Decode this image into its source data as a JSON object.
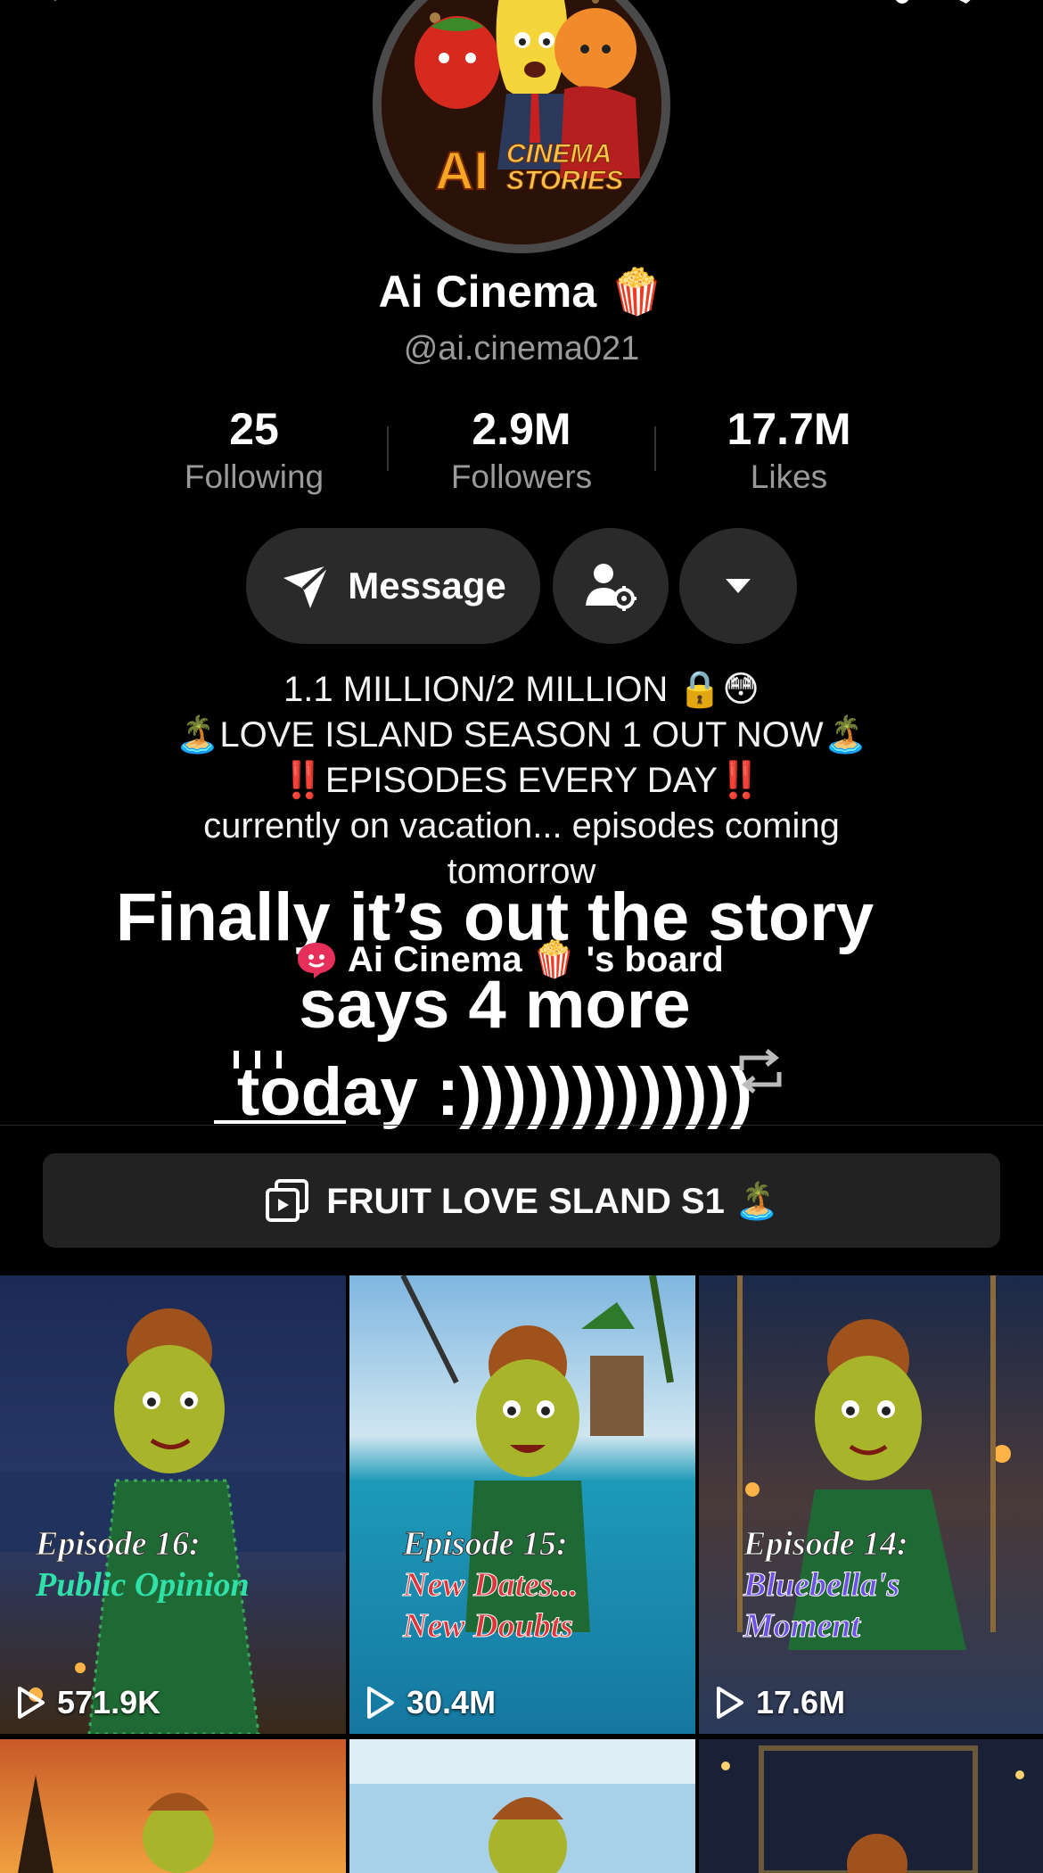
{
  "profile": {
    "name": "Ai Cinema",
    "name_emoji": "🍿",
    "handle": "@ai.cinema021",
    "avatar_text": [
      "AI",
      "CINEMA",
      "STORIES"
    ]
  },
  "stats": [
    {
      "value": "25",
      "label": "Following"
    },
    {
      "value": "2.9M",
      "label": "Followers"
    },
    {
      "value": "17.7M",
      "label": "Likes"
    }
  ],
  "actions": {
    "message_label": "Message"
  },
  "bio": {
    "line1": "1.1 MILLION/2 MILLION 🔒😳",
    "line2": "🏝️LOVE ISLAND SEASON 1 OUT NOW🏝️",
    "line3_marks": "‼️",
    "line3_text": "EPISODES EVERY DAY",
    "line4": "currently on vacation... episodes coming",
    "line5": "tomorrow"
  },
  "overlay_caption": {
    "line1": "Finally it’s out the story",
    "line2": "says 4 more",
    "line3": "today :)))))))))))))"
  },
  "board": {
    "label": "Ai Cinema 🍿 's board"
  },
  "playlist": {
    "label": "FRUIT LOVE SLAND S1 🏝️"
  },
  "videos": [
    {
      "title": "Episode 16:",
      "subtitle": [
        "Public Opinion"
      ],
      "views": "571.9K",
      "subtitle_color": "#2fe0a8"
    },
    {
      "title": "Episode 15:",
      "subtitle": [
        "New Dates...",
        "New Doubts"
      ],
      "views": "30.4M",
      "subtitle_color": "#e0343b"
    },
    {
      "title": "Episode 14:",
      "subtitle": [
        "Bluebella's",
        "Moment"
      ],
      "views": "17.6M",
      "subtitle_color": "#6a4fe8"
    }
  ],
  "colors": {
    "background": "#000000",
    "button_bg": "#2a2a2a",
    "secondary_text": "#9a9a9a",
    "accent_red": "#e21b1b"
  }
}
